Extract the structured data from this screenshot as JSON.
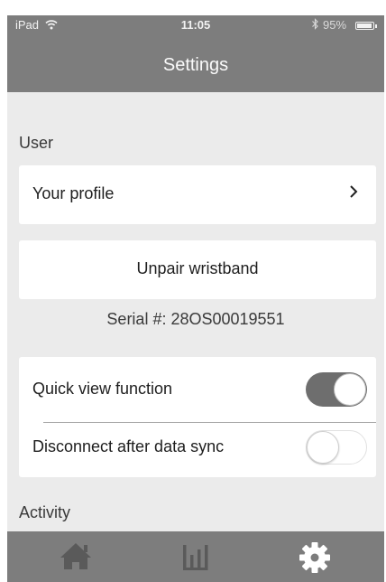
{
  "status_bar": {
    "carrier": "iPad",
    "wifi_icon": "wifi-icon",
    "time": "11:05",
    "bluetooth_icon": "bluetooth-icon",
    "battery_text": "95%",
    "battery_level": 0.95
  },
  "header": {
    "title": "Settings"
  },
  "sections": {
    "user_label": "User",
    "activity_label": "Activity"
  },
  "profile_row": {
    "label": "Your profile",
    "chevron": "›"
  },
  "unpair_button": {
    "label": "Unpair wristband"
  },
  "serial": {
    "text": "Serial #: 28OS00019551"
  },
  "toggles": {
    "quick_view": {
      "label": "Quick view function",
      "on": true
    },
    "disconnect": {
      "label": "Disconnect after data sync",
      "on": false
    }
  },
  "tabbar": {
    "items": [
      {
        "icon": "home-icon",
        "active": false
      },
      {
        "icon": "stats-icon",
        "active": false
      },
      {
        "icon": "gear-icon",
        "active": true
      }
    ]
  },
  "colors": {
    "header_bg": "#7d7d7d",
    "screen_bg": "#ebebeb",
    "toggle_on": "#6e6e6e",
    "tab_icon_inactive": "#5a5a5a",
    "tab_icon_active": "#ffffff"
  }
}
